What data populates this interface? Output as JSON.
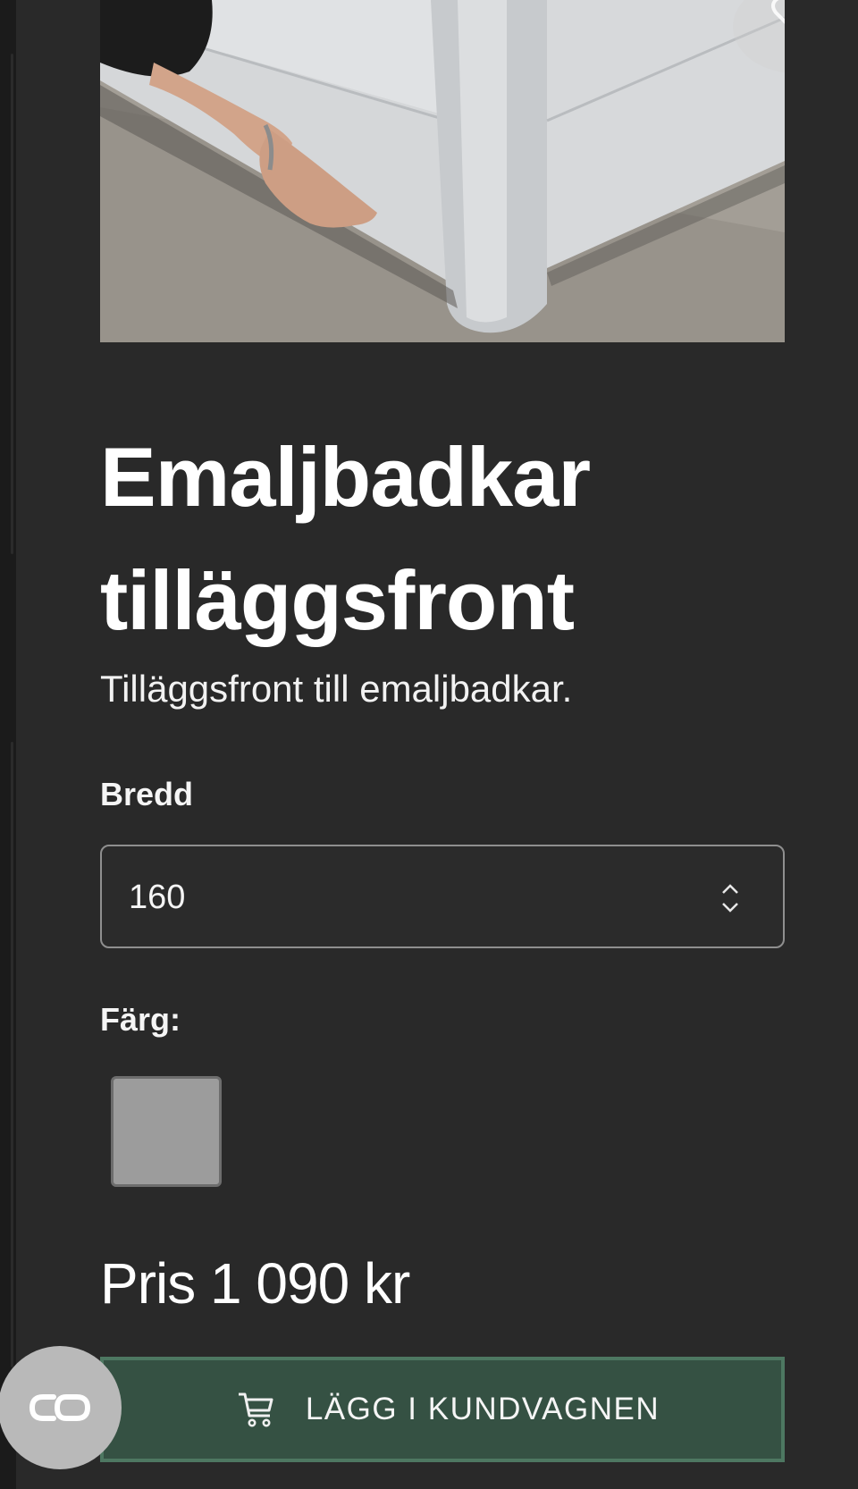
{
  "product": {
    "title": "Emaljbadkar tilläggsfront",
    "subtitle": "Tilläggsfront till emaljbadkar.",
    "image_icon": "wishlist-heart-icon"
  },
  "options": {
    "width_label": "Bredd",
    "width_value": "160",
    "color_label": "Färg:",
    "selected_color": "#9c9c9c"
  },
  "price": {
    "text": "Pris 1 090 kr"
  },
  "cart": {
    "button_label": "LÄGG I KUNDVAGNEN",
    "icon": "cart-icon"
  },
  "colors": {
    "page_background": "#292929",
    "button_background": "#355143",
    "button_border": "#4d7761"
  }
}
